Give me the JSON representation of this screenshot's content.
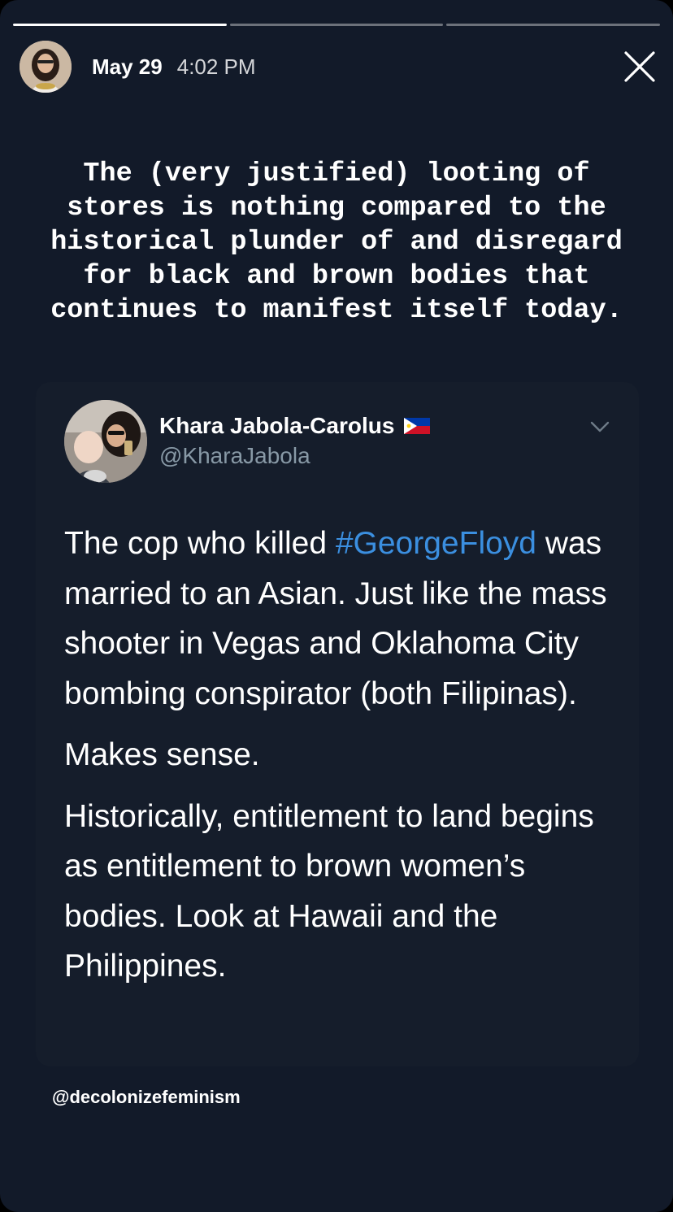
{
  "story": {
    "progress_fill": [
      1.0,
      0.0,
      0.0
    ],
    "date": "May 29",
    "time": "4:02 PM",
    "close_icon": "close-icon",
    "caption": "The (very justified) looting of\nstores is nothing compared to the\nhistorical plunder of and disregard\nfor black and brown bodies that\ncontinues to manifest itself today."
  },
  "tweet": {
    "name": "Khara Jabola-Carolus",
    "flag": "philippines-flag-icon",
    "handle": "@KharaJabola",
    "body": {
      "p1_before": "The cop who killed ",
      "p1_hashtag": "#GeorgeFloyd",
      "p1_after": " was married to an Asian. Just like the mass shooter in Vegas and Oklahoma City bombing conspirator (both Filipinas).",
      "p2": "Makes sense.",
      "p3": "Historically, entitlement to land begins as entitlement to brown women’s bodies. Look at Hawaii and the Philippines."
    }
  },
  "watermark": "@decolonizefeminism",
  "colors": {
    "background": "#121a29",
    "hashtag": "#3b8fe0",
    "handle": "#8899a6"
  }
}
